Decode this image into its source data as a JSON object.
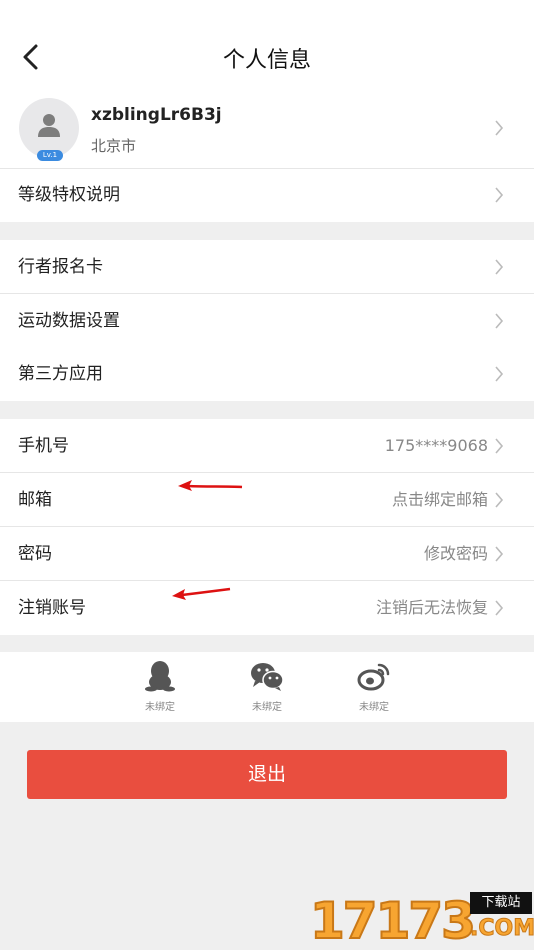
{
  "header": {
    "title": "个人信息"
  },
  "profile": {
    "username": "xzblingLr6B3j",
    "city": "北京市",
    "level": "Lv.1"
  },
  "privilege": {
    "label": "等级特权说明"
  },
  "group1": [
    {
      "label": "行者报名卡"
    },
    {
      "label": "运动数据设置"
    },
    {
      "label": "第三方应用"
    }
  ],
  "group2": [
    {
      "label": "手机号",
      "value": "175****9068"
    },
    {
      "label": "邮箱",
      "value": "点击绑定邮箱"
    },
    {
      "label": "密码",
      "value": "修改密码"
    },
    {
      "label": "注销账号",
      "value": "注销后无法恢复"
    }
  ],
  "social": [
    {
      "icon": "qq-icon",
      "caption": "未绑定"
    },
    {
      "icon": "wechat-icon",
      "caption": "未绑定"
    },
    {
      "icon": "weibo-icon",
      "caption": "未绑定"
    }
  ],
  "logout": {
    "label": "退出"
  },
  "watermark": {
    "digits": "17173",
    "tag": "下载站",
    "domain": ".COM"
  },
  "colors": {
    "accent": "#e94e3f",
    "level_badge": "#3b8be0",
    "annotation_arrow": "#dd1111"
  }
}
